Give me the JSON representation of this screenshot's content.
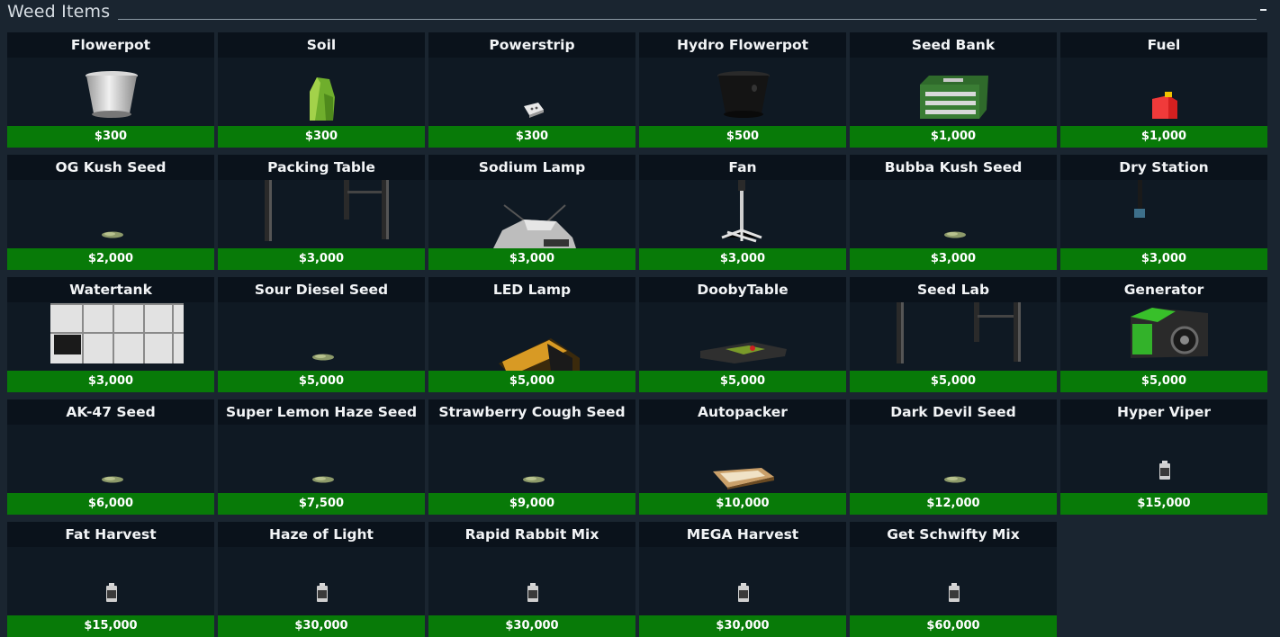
{
  "panel": {
    "title": "Weed Items",
    "minimize_glyph": "-"
  },
  "items": [
    {
      "name": "Flowerpot",
      "price": "$300",
      "icon": "flowerpot-icon"
    },
    {
      "name": "Soil",
      "price": "$300",
      "icon": "soil-bag-icon"
    },
    {
      "name": "Powerstrip",
      "price": "$300",
      "icon": "powerstrip-icon"
    },
    {
      "name": "Hydro Flowerpot",
      "price": "$500",
      "icon": "hydro-flowerpot-icon"
    },
    {
      "name": "Seed Bank",
      "price": "$1,000",
      "icon": "seed-bank-icon"
    },
    {
      "name": "Fuel",
      "price": "$1,000",
      "icon": "fuel-can-icon"
    },
    {
      "name": "OG Kush Seed",
      "price": "$2,000",
      "icon": "seed-icon"
    },
    {
      "name": "Packing Table",
      "price": "$3,000",
      "icon": "packing-table-icon"
    },
    {
      "name": "Sodium Lamp",
      "price": "$3,000",
      "icon": "sodium-lamp-icon"
    },
    {
      "name": "Fan",
      "price": "$3,000",
      "icon": "fan-stand-icon"
    },
    {
      "name": "Bubba Kush Seed",
      "price": "$3,000",
      "icon": "seed-icon"
    },
    {
      "name": "Dry Station",
      "price": "$3,000",
      "icon": "dry-station-icon"
    },
    {
      "name": "Watertank",
      "price": "$3,000",
      "icon": "watertank-icon"
    },
    {
      "name": "Sour Diesel Seed",
      "price": "$5,000",
      "icon": "seed-icon"
    },
    {
      "name": "LED Lamp",
      "price": "$5,000",
      "icon": "led-lamp-icon"
    },
    {
      "name": "DoobyTable",
      "price": "$5,000",
      "icon": "dooby-table-icon"
    },
    {
      "name": "Seed Lab",
      "price": "$5,000",
      "icon": "seed-lab-icon"
    },
    {
      "name": "Generator",
      "price": "$5,000",
      "icon": "generator-icon"
    },
    {
      "name": "AK-47 Seed",
      "price": "$6,000",
      "icon": "seed-icon"
    },
    {
      "name": "Super Lemon Haze Seed",
      "price": "$7,500",
      "icon": "seed-icon"
    },
    {
      "name": "Strawberry Cough Seed",
      "price": "$9,000",
      "icon": "seed-icon"
    },
    {
      "name": "Autopacker",
      "price": "$10,000",
      "icon": "autopacker-icon"
    },
    {
      "name": "Dark Devil Seed",
      "price": "$12,000",
      "icon": "seed-icon"
    },
    {
      "name": "Hyper Viper",
      "price": "$15,000",
      "icon": "fertilizer-bottle-icon"
    },
    {
      "name": "Fat Harvest",
      "price": "$15,000",
      "icon": "fertilizer-bottle-icon"
    },
    {
      "name": "Haze of Light",
      "price": "$30,000",
      "icon": "fertilizer-bottle-icon"
    },
    {
      "name": "Rapid Rabbit Mix",
      "price": "$30,000",
      "icon": "fertilizer-bottle-icon"
    },
    {
      "name": "MEGA Harvest",
      "price": "$30,000",
      "icon": "fertilizer-bottle-icon"
    },
    {
      "name": "Get Schwifty Mix",
      "price": "$60,000",
      "icon": "fertilizer-bottle-icon"
    }
  ],
  "colors": {
    "background": "#1a2530",
    "card": "#0f1923",
    "card_title": "#0a121b",
    "price_bar": "#087a08"
  }
}
